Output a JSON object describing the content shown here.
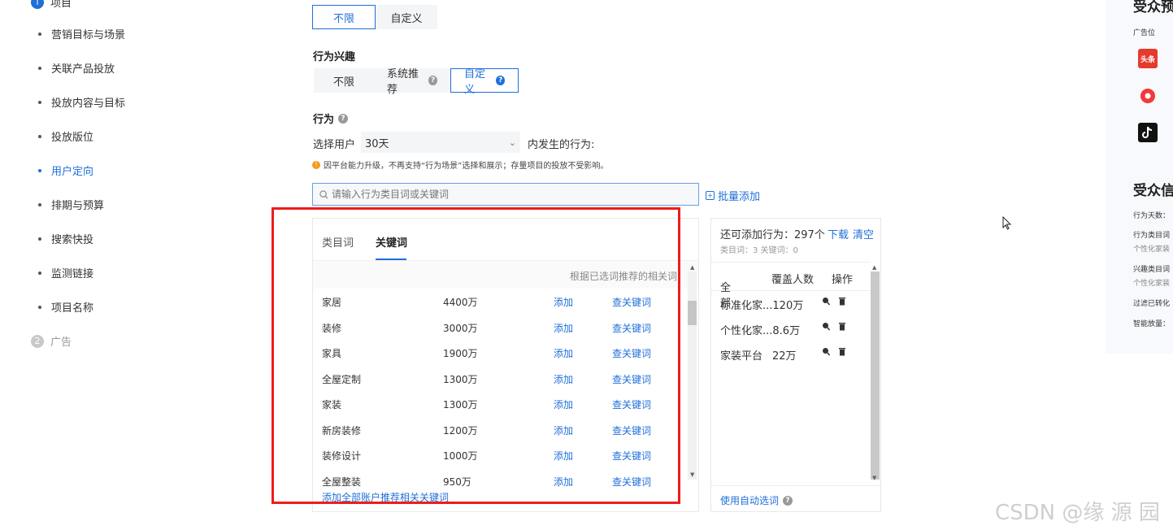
{
  "sidebar": {
    "step1_label": "项目",
    "items": [
      {
        "label": "营销目标与场景",
        "active": false
      },
      {
        "label": "关联产品投放",
        "active": false
      },
      {
        "label": "投放内容与目标",
        "active": false
      },
      {
        "label": "投放版位",
        "active": false
      },
      {
        "label": "用户定向",
        "active": true
      },
      {
        "label": "排期与预算",
        "active": false
      },
      {
        "label": "搜索快投",
        "active": false
      },
      {
        "label": "监测链接",
        "active": false
      },
      {
        "label": "项目名称",
        "active": false
      }
    ],
    "step2_number": "2",
    "step2_label": "广告"
  },
  "top_segment": {
    "unlimited": "不限",
    "custom": "自定义"
  },
  "interest": {
    "title": "行为兴趣",
    "unlimited": "不限",
    "system": "系统推荐",
    "custom": "自定义"
  },
  "behavior": {
    "title": "行为",
    "select_prefix": "选择用户",
    "days_value": "30天",
    "select_suffix": "内发生的行为:",
    "notice": "因平台能力升级，不再支持“行为场景”选择和展示；存量项目的投放不受影响。",
    "search_placeholder": "请输入行为类目词或关键词",
    "batch_add": "批量添加"
  },
  "keyword_panel": {
    "tab_category": "类目词",
    "tab_keyword": "关键词",
    "recommend_text": "根据已选词推荐的相关词",
    "add_label": "添加",
    "related_label": "查关键词",
    "rows": [
      {
        "name": "家居",
        "coverage": "4400万"
      },
      {
        "name": "装修",
        "coverage": "3000万"
      },
      {
        "name": "家具",
        "coverage": "1900万"
      },
      {
        "name": "全屋定制",
        "coverage": "1300万"
      },
      {
        "name": "家装",
        "coverage": "1300万"
      },
      {
        "name": "新房装修",
        "coverage": "1200万"
      },
      {
        "name": "装修设计",
        "coverage": "1000万"
      },
      {
        "name": "全屋整装",
        "coverage": "950万"
      }
    ],
    "add_all": "添加全部账户推荐相关关键词"
  },
  "selected_panel": {
    "remaining": "还可添加行为：297个",
    "download": "下载",
    "clear": "清空",
    "counts": "类目词：3   关键词：0",
    "col_all": "全部",
    "col_coverage": "覆盖人数",
    "col_action": "操作",
    "rows": [
      {
        "name": "标准化家...",
        "coverage": "120万"
      },
      {
        "name": "个性化家...",
        "coverage": "8.6万"
      },
      {
        "name": "家装平台",
        "coverage": "22万"
      }
    ],
    "auto_pick": "使用自动选词"
  },
  "right_panel": {
    "title1": "受众预",
    "placement_label": "广告位",
    "toutiao_logo_text": "头条",
    "title2": "受众信",
    "lines": [
      "行为天数：",
      "行为类目词",
      "个性化家装",
      "兴趣类目词",
      "个性化家装",
      "过滤已转化",
      "智能放量："
    ]
  },
  "watermark": "CSDN @缘  源  园",
  "colors": {
    "accent": "#1f6fd9",
    "highlight_box": "#ee1c1c",
    "warning": "#f39a1a"
  }
}
